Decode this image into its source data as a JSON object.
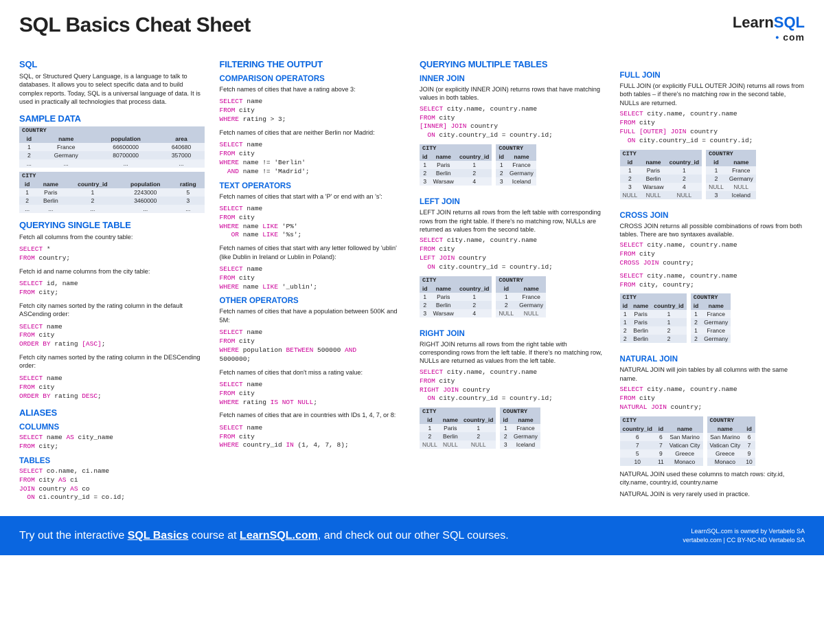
{
  "title": "SQL Basics Cheat Sheet",
  "logo": {
    "learn": "Learn",
    "sql": "SQL",
    "com": "com"
  },
  "intro": {
    "heading": "SQL",
    "text": "SQL, or Structured Query Language, is a language to talk to databases. It allows you to select specific data and to build complex reports. Today, SQL is a universal language of data. It is used in practically all technologies that process data."
  },
  "sample": {
    "heading": "SAMPLE DATA",
    "country": {
      "label": "COUNTRY",
      "cols": [
        "id",
        "name",
        "population",
        "area"
      ],
      "rows": [
        [
          "1",
          "France",
          "66600000",
          "640680"
        ],
        [
          "2",
          "Germany",
          "80700000",
          "357000"
        ],
        [
          "...",
          "...",
          "...",
          "..."
        ]
      ]
    },
    "city": {
      "label": "CITY",
      "cols": [
        "id",
        "name",
        "country_id",
        "population",
        "rating"
      ],
      "rows": [
        [
          "1",
          "Paris",
          "1",
          "2243000",
          "5"
        ],
        [
          "2",
          "Berlin",
          "2",
          "3460000",
          "3"
        ],
        [
          "...",
          "...",
          "...",
          "...",
          "..."
        ]
      ]
    }
  },
  "qsingle": {
    "heading": "QUERYING SINGLE TABLE",
    "items": [
      {
        "desc": "Fetch all columns from the country table:",
        "code": [
          [
            "SELECT",
            " *"
          ],
          [
            "FROM",
            " country;"
          ]
        ]
      },
      {
        "desc": "Fetch id and name columns from the city table:",
        "code": [
          [
            "SELECT",
            " id, name"
          ],
          [
            "FROM",
            " city;"
          ]
        ]
      },
      {
        "desc": "Fetch city names sorted by the rating column in the default ASCending order:",
        "code": [
          [
            "SELECT",
            " name"
          ],
          [
            "FROM",
            " city"
          ],
          [
            "ORDER BY",
            " rating ",
            "[ASC]",
            ";"
          ]
        ]
      },
      {
        "desc": "Fetch city names sorted by the rating column in the DESCending order:",
        "code": [
          [
            "SELECT",
            " name"
          ],
          [
            "FROM",
            " city"
          ],
          [
            "ORDER BY",
            " rating ",
            "DESC",
            ";"
          ]
        ]
      }
    ]
  },
  "aliases": {
    "heading": "ALIASES",
    "columns": {
      "heading": "COLUMNS",
      "code": [
        [
          "SELECT",
          " name ",
          "AS",
          " city_name"
        ],
        [
          "FROM",
          " city;"
        ]
      ]
    },
    "tables": {
      "heading": "TABLES",
      "code": [
        [
          "SELECT",
          " co.name, ci.name"
        ],
        [
          "FROM",
          " city ",
          "AS",
          " ci"
        ],
        [
          "JOIN",
          " country ",
          "AS",
          " co"
        ],
        [
          "  ",
          "ON",
          " ci.country_id = co.id;"
        ]
      ]
    }
  },
  "filtering": {
    "heading": "FILTERING THE OUTPUT",
    "comp": {
      "heading": "COMPARISON OPERATORS",
      "items": [
        {
          "desc": "Fetch names of cities that have a rating above 3:",
          "code": [
            [
              "SELECT",
              " name"
            ],
            [
              "FROM",
              " city"
            ],
            [
              "WHERE",
              " rating > 3;"
            ]
          ]
        },
        {
          "desc": "Fetch names of cities that are neither Berlin nor Madrid:",
          "code": [
            [
              "SELECT",
              " name"
            ],
            [
              "FROM",
              " city"
            ],
            [
              "WHERE",
              " name != 'Berlin'"
            ],
            [
              "  ",
              "AND",
              " name != 'Madrid';"
            ]
          ]
        }
      ]
    },
    "text": {
      "heading": "TEXT OPERATORS",
      "items": [
        {
          "desc": "Fetch names of cities that start with a 'P' or end with an 's':",
          "code": [
            [
              "SELECT",
              " name"
            ],
            [
              "FROM",
              " city"
            ],
            [
              "WHERE",
              " name ",
              "LIKE",
              " 'P%'"
            ],
            [
              "   ",
              "OR",
              " name ",
              "LIKE",
              " '%s';"
            ]
          ]
        },
        {
          "desc": "Fetch names of cities that start with any letter followed by 'ublin' (like Dublin in Ireland or Lublin in Poland):",
          "code": [
            [
              "SELECT",
              " name"
            ],
            [
              "FROM",
              " city"
            ],
            [
              "WHERE",
              " name ",
              "LIKE",
              " '_ublin';"
            ]
          ]
        }
      ]
    },
    "other": {
      "heading": "OTHER OPERATORS",
      "items": [
        {
          "desc": "Fetch names of cities that have a population between 500K and 5M:",
          "code": [
            [
              "SELECT",
              " name"
            ],
            [
              "FROM",
              " city"
            ],
            [
              "WHERE",
              " population ",
              "BETWEEN",
              " 500000 ",
              "AND",
              ""
            ],
            [
              "5000000;"
            ]
          ]
        },
        {
          "desc": "Fetch names of cities that don't miss a rating value:",
          "code": [
            [
              "SELECT",
              " name"
            ],
            [
              "FROM",
              " city"
            ],
            [
              "WHERE",
              " rating ",
              "IS NOT NULL",
              ";"
            ]
          ]
        },
        {
          "desc": "Fetch names of cities that are in countries with IDs 1, 4, 7, or 8:",
          "code": [
            [
              "SELECT",
              " name"
            ],
            [
              "FROM",
              " city"
            ],
            [
              "WHERE",
              " country_id ",
              "IN",
              " (1, 4, 7, 8);"
            ]
          ]
        }
      ]
    }
  },
  "multi": {
    "heading": "QUERYING MULTIPLE TABLES",
    "inner": {
      "heading": "INNER JOIN",
      "desc": "JOIN (or explicitly INNER JOIN) returns rows that have matching values in both tables.",
      "code": [
        [
          "SELECT",
          " city.name, country.name"
        ],
        [
          "FROM",
          " city"
        ],
        [
          "[INNER] JOIN",
          " country"
        ],
        [
          "  ",
          "ON",
          " city.country_id = country.id;"
        ]
      ],
      "city": {
        "cols": [
          "id",
          "name",
          "country_id"
        ],
        "rows": [
          [
            "1",
            "Paris",
            "1"
          ],
          [
            "2",
            "Berlin",
            "2"
          ],
          [
            "3",
            "Warsaw",
            "4"
          ]
        ]
      },
      "country": {
        "cols": [
          "id",
          "name"
        ],
        "rows": [
          [
            "1",
            "France"
          ],
          [
            "2",
            "Germany"
          ],
          [
            "3",
            "Iceland"
          ]
        ]
      }
    },
    "left": {
      "heading": "LEFT JOIN",
      "desc": "LEFT JOIN returns all rows from the left table with corresponding rows from the right table. If there's no matching row, NULLs are returned as values from the second table.",
      "code": [
        [
          "SELECT",
          " city.name, country.name"
        ],
        [
          "FROM",
          " city"
        ],
        [
          "LEFT JOIN",
          " country"
        ],
        [
          "  ",
          "ON",
          " city.country_id = country.id;"
        ]
      ],
      "city": {
        "cols": [
          "id",
          "name",
          "country_id"
        ],
        "rows": [
          [
            "1",
            "Paris",
            "1"
          ],
          [
            "2",
            "Berlin",
            "2"
          ],
          [
            "3",
            "Warsaw",
            "4"
          ]
        ]
      },
      "country": {
        "cols": [
          "id",
          "name"
        ],
        "rows": [
          [
            "1",
            "France"
          ],
          [
            "2",
            "Germany"
          ],
          [
            "NULL",
            "NULL"
          ]
        ]
      }
    },
    "right": {
      "heading": "RIGHT JOIN",
      "desc": "RIGHT JOIN returns all rows from the right table with corresponding rows from the left table. If there's no matching row, NULLs are returned as values from the left table.",
      "code": [
        [
          "SELECT",
          " city.name, country.name"
        ],
        [
          "FROM",
          " city"
        ],
        [
          "RIGHT JOIN",
          " country"
        ],
        [
          "  ",
          "ON",
          " city.country_id = country.id;"
        ]
      ],
      "city": {
        "cols": [
          "id",
          "name",
          "country_id"
        ],
        "rows": [
          [
            "1",
            "Paris",
            "1"
          ],
          [
            "2",
            "Berlin",
            "2"
          ],
          [
            "NULL",
            "NULL",
            "NULL"
          ]
        ]
      },
      "country": {
        "cols": [
          "id",
          "name"
        ],
        "rows": [
          [
            "1",
            "France"
          ],
          [
            "2",
            "Germany"
          ],
          [
            "3",
            "Iceland"
          ]
        ]
      }
    },
    "full": {
      "heading": "FULL JOIN",
      "desc": "FULL JOIN (or explicitly FULL OUTER JOIN) returns all rows from both tables – if there's no matching row in the second table, NULLs are returned.",
      "code": [
        [
          "SELECT",
          " city.name, country.name"
        ],
        [
          "FROM",
          " city"
        ],
        [
          "FULL [OUTER] JOIN",
          " country"
        ],
        [
          "  ",
          "ON",
          " city.country_id = country.id;"
        ]
      ],
      "city": {
        "cols": [
          "id",
          "name",
          "country_id"
        ],
        "rows": [
          [
            "1",
            "Paris",
            "1"
          ],
          [
            "2",
            "Berlin",
            "2"
          ],
          [
            "3",
            "Warsaw",
            "4"
          ],
          [
            "NULL",
            "NULL",
            "NULL"
          ]
        ]
      },
      "country": {
        "cols": [
          "id",
          "name"
        ],
        "rows": [
          [
            "1",
            "France"
          ],
          [
            "2",
            "Germany"
          ],
          [
            "NULL",
            "NULL"
          ],
          [
            "3",
            "Iceland"
          ]
        ]
      }
    },
    "cross": {
      "heading": "CROSS JOIN",
      "desc": "CROSS JOIN returns all possible combinations of rows from both tables. There are two syntaxes available.",
      "code1": [
        [
          "SELECT",
          " city.name, country.name"
        ],
        [
          "FROM",
          " city"
        ],
        [
          "CROSS JOIN",
          " country;"
        ]
      ],
      "code2": [
        [
          "SELECT",
          " city.name, country.name"
        ],
        [
          "FROM",
          " city, country;"
        ]
      ],
      "city": {
        "cols": [
          "id",
          "name",
          "country_id"
        ],
        "rows": [
          [
            "1",
            "Paris",
            "1"
          ],
          [
            "1",
            "Paris",
            "1"
          ],
          [
            "2",
            "Berlin",
            "2"
          ],
          [
            "2",
            "Berlin",
            "2"
          ]
        ]
      },
      "country": {
        "cols": [
          "id",
          "name"
        ],
        "rows": [
          [
            "1",
            "France"
          ],
          [
            "2",
            "Germany"
          ],
          [
            "1",
            "France"
          ],
          [
            "2",
            "Germany"
          ]
        ]
      }
    },
    "natural": {
      "heading": "NATURAL JOIN",
      "desc": "NATURAL JOIN will join tables by all columns with the same name.",
      "code": [
        [
          "SELECT",
          " city.name, country.name"
        ],
        [
          "FROM",
          " city"
        ],
        [
          "NATURAL JOIN",
          " country;"
        ]
      ],
      "city": {
        "cols": [
          "country_id",
          "id",
          "name"
        ],
        "rows": [
          [
            "6",
            "6",
            "San Marino"
          ],
          [
            "7",
            "7",
            "Vatican City"
          ],
          [
            "5",
            "9",
            "Greece"
          ],
          [
            "10",
            "11",
            "Monaco"
          ]
        ]
      },
      "country": {
        "cols": [
          "name",
          "id"
        ],
        "rows": [
          [
            "San Marino",
            "6"
          ],
          [
            "Vatican City",
            "7"
          ],
          [
            "Greece",
            "9"
          ],
          [
            "Monaco",
            "10"
          ]
        ]
      },
      "note1": "NATURAL JOIN used these columns to match rows: city.id, city.name, country.id, country.name",
      "note2": "NATURAL JOIN is very rarely used in practice."
    }
  },
  "footer": {
    "left_pre": "Try out the interactive ",
    "left_link1": "SQL Basics",
    "left_mid": " course at ",
    "left_link2": "LearnSQL.com",
    "left_post": ", and check out our other SQL courses.",
    "right1": "LearnSQL.com is owned by Vertabelo SA",
    "right2": "vertabelo.com | CC BY-NC-ND Vertabelo SA"
  }
}
